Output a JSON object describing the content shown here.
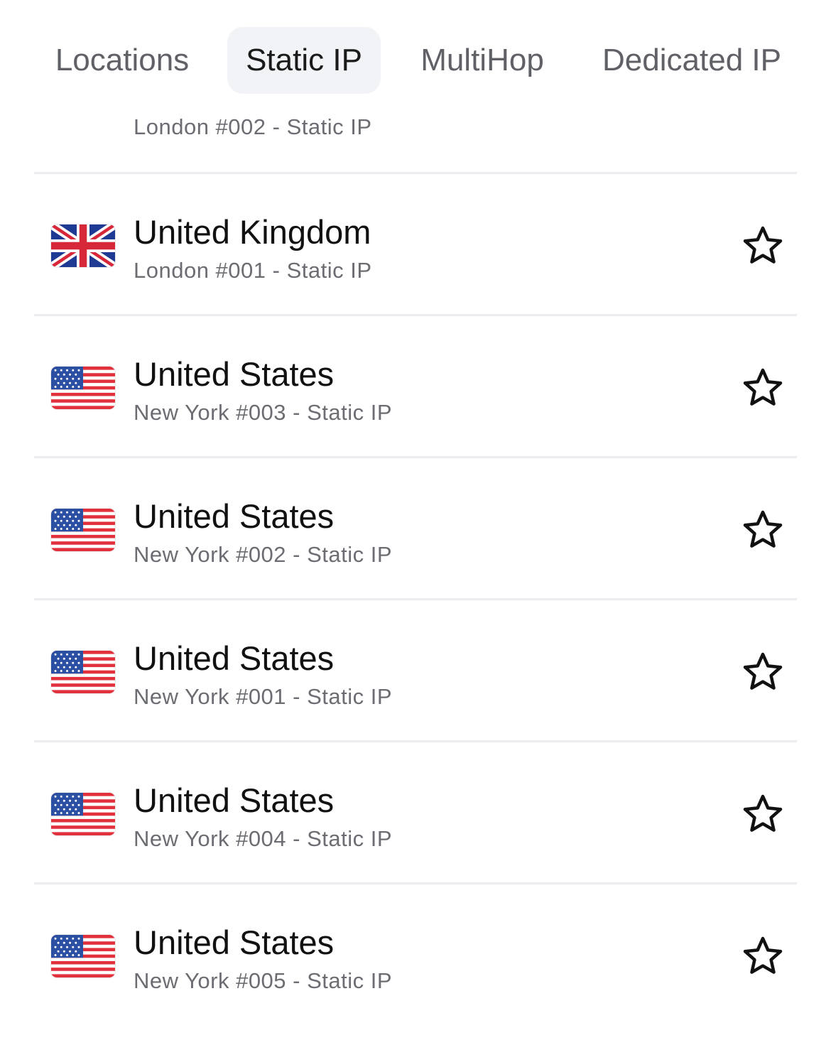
{
  "tabs": {
    "locations": "Locations",
    "static_ip": "Static IP",
    "multihop": "MultiHop",
    "dedicated_ip": "Dedicated IP",
    "active": "Static IP"
  },
  "partial_row": {
    "subtitle": "London #002 - Static IP"
  },
  "rows": [
    {
      "country": "United Kingdom",
      "location": "London #001 - Static IP",
      "flag": "uk-flag-icon",
      "favorite": false
    },
    {
      "country": "United States",
      "location": "New York #003 - Static IP",
      "flag": "us-flag-icon",
      "favorite": false
    },
    {
      "country": "United States",
      "location": "New York #002 - Static IP",
      "flag": "us-flag-icon",
      "favorite": false
    },
    {
      "country": "United States",
      "location": "New York #001 - Static IP",
      "flag": "us-flag-icon",
      "favorite": false
    },
    {
      "country": "United States",
      "location": "New York #004 - Static IP",
      "flag": "us-flag-icon",
      "favorite": false
    },
    {
      "country": "United States",
      "location": "New York #005 - Static IP",
      "flag": "us-flag-icon",
      "favorite": false
    }
  ],
  "colors": {
    "active_tab_bg": "#f2f3f6",
    "divider": "#ebecef",
    "subtitle": "#6b6d72",
    "inactive_tab": "#5f6166"
  }
}
